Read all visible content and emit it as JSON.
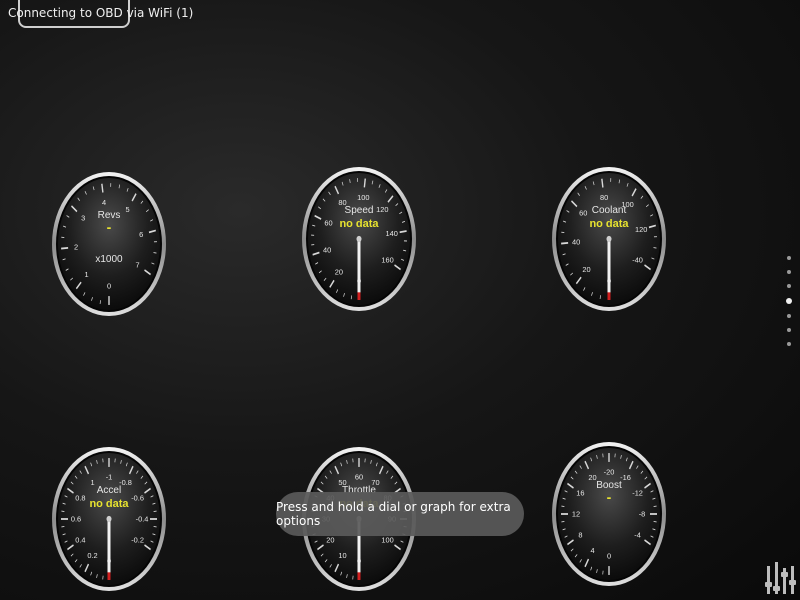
{
  "status": {
    "text": "Connecting to OBD via WiFi (1)"
  },
  "toast": {
    "text": "Press and hold a dial or graph for extra options"
  },
  "colors": {
    "accent": "#e7e22f",
    "needle": "#f2f2f2",
    "needle_tip": "#d11f1f"
  },
  "icons": {
    "settings": "sliders-icon"
  },
  "pager": {
    "count": 7,
    "active": 3
  },
  "gauges": [
    {
      "id": "revs",
      "label": "Revs",
      "value": "-",
      "unit": "x1000",
      "ticks": [
        "0",
        "1",
        "2",
        "3",
        "4",
        "5",
        "6",
        "7"
      ],
      "needle_fraction": 0
    },
    {
      "id": "speed",
      "label": "Speed",
      "value": "no data",
      "unit": "",
      "ticks": [
        "0",
        "20",
        "40",
        "60",
        "80",
        "100",
        "120",
        "140",
        "160"
      ],
      "needle_fraction": 0
    },
    {
      "id": "coolant",
      "label": "Coolant",
      "value": "no data",
      "unit": "",
      "ticks": [
        "0",
        "20",
        "40",
        "60",
        "80",
        "100",
        "120",
        "-40"
      ],
      "needle_fraction": 0
    },
    {
      "id": "accel",
      "label": "Accel",
      "value": "no data",
      "unit": "",
      "ticks": [
        "0",
        "0.2",
        "0.4",
        "0.6",
        "0.8",
        "1",
        "-1",
        "-0.8",
        "-0.6",
        "-0.4",
        "-0.2"
      ],
      "needle_fraction": 0
    },
    {
      "id": "throttle",
      "label": "Throttle",
      "value": "no data",
      "unit": "",
      "ticks": [
        "0",
        "10",
        "20",
        "30",
        "40",
        "50",
        "60",
        "70",
        "80",
        "90",
        "100"
      ],
      "needle_fraction": 0
    },
    {
      "id": "boost",
      "label": "Boost",
      "value": "-",
      "unit": "",
      "ticks": [
        "0",
        "4",
        "8",
        "12",
        "16",
        "20",
        "-20",
        "-16",
        "-12",
        "-8",
        "-4"
      ],
      "needle_fraction": 0
    }
  ]
}
